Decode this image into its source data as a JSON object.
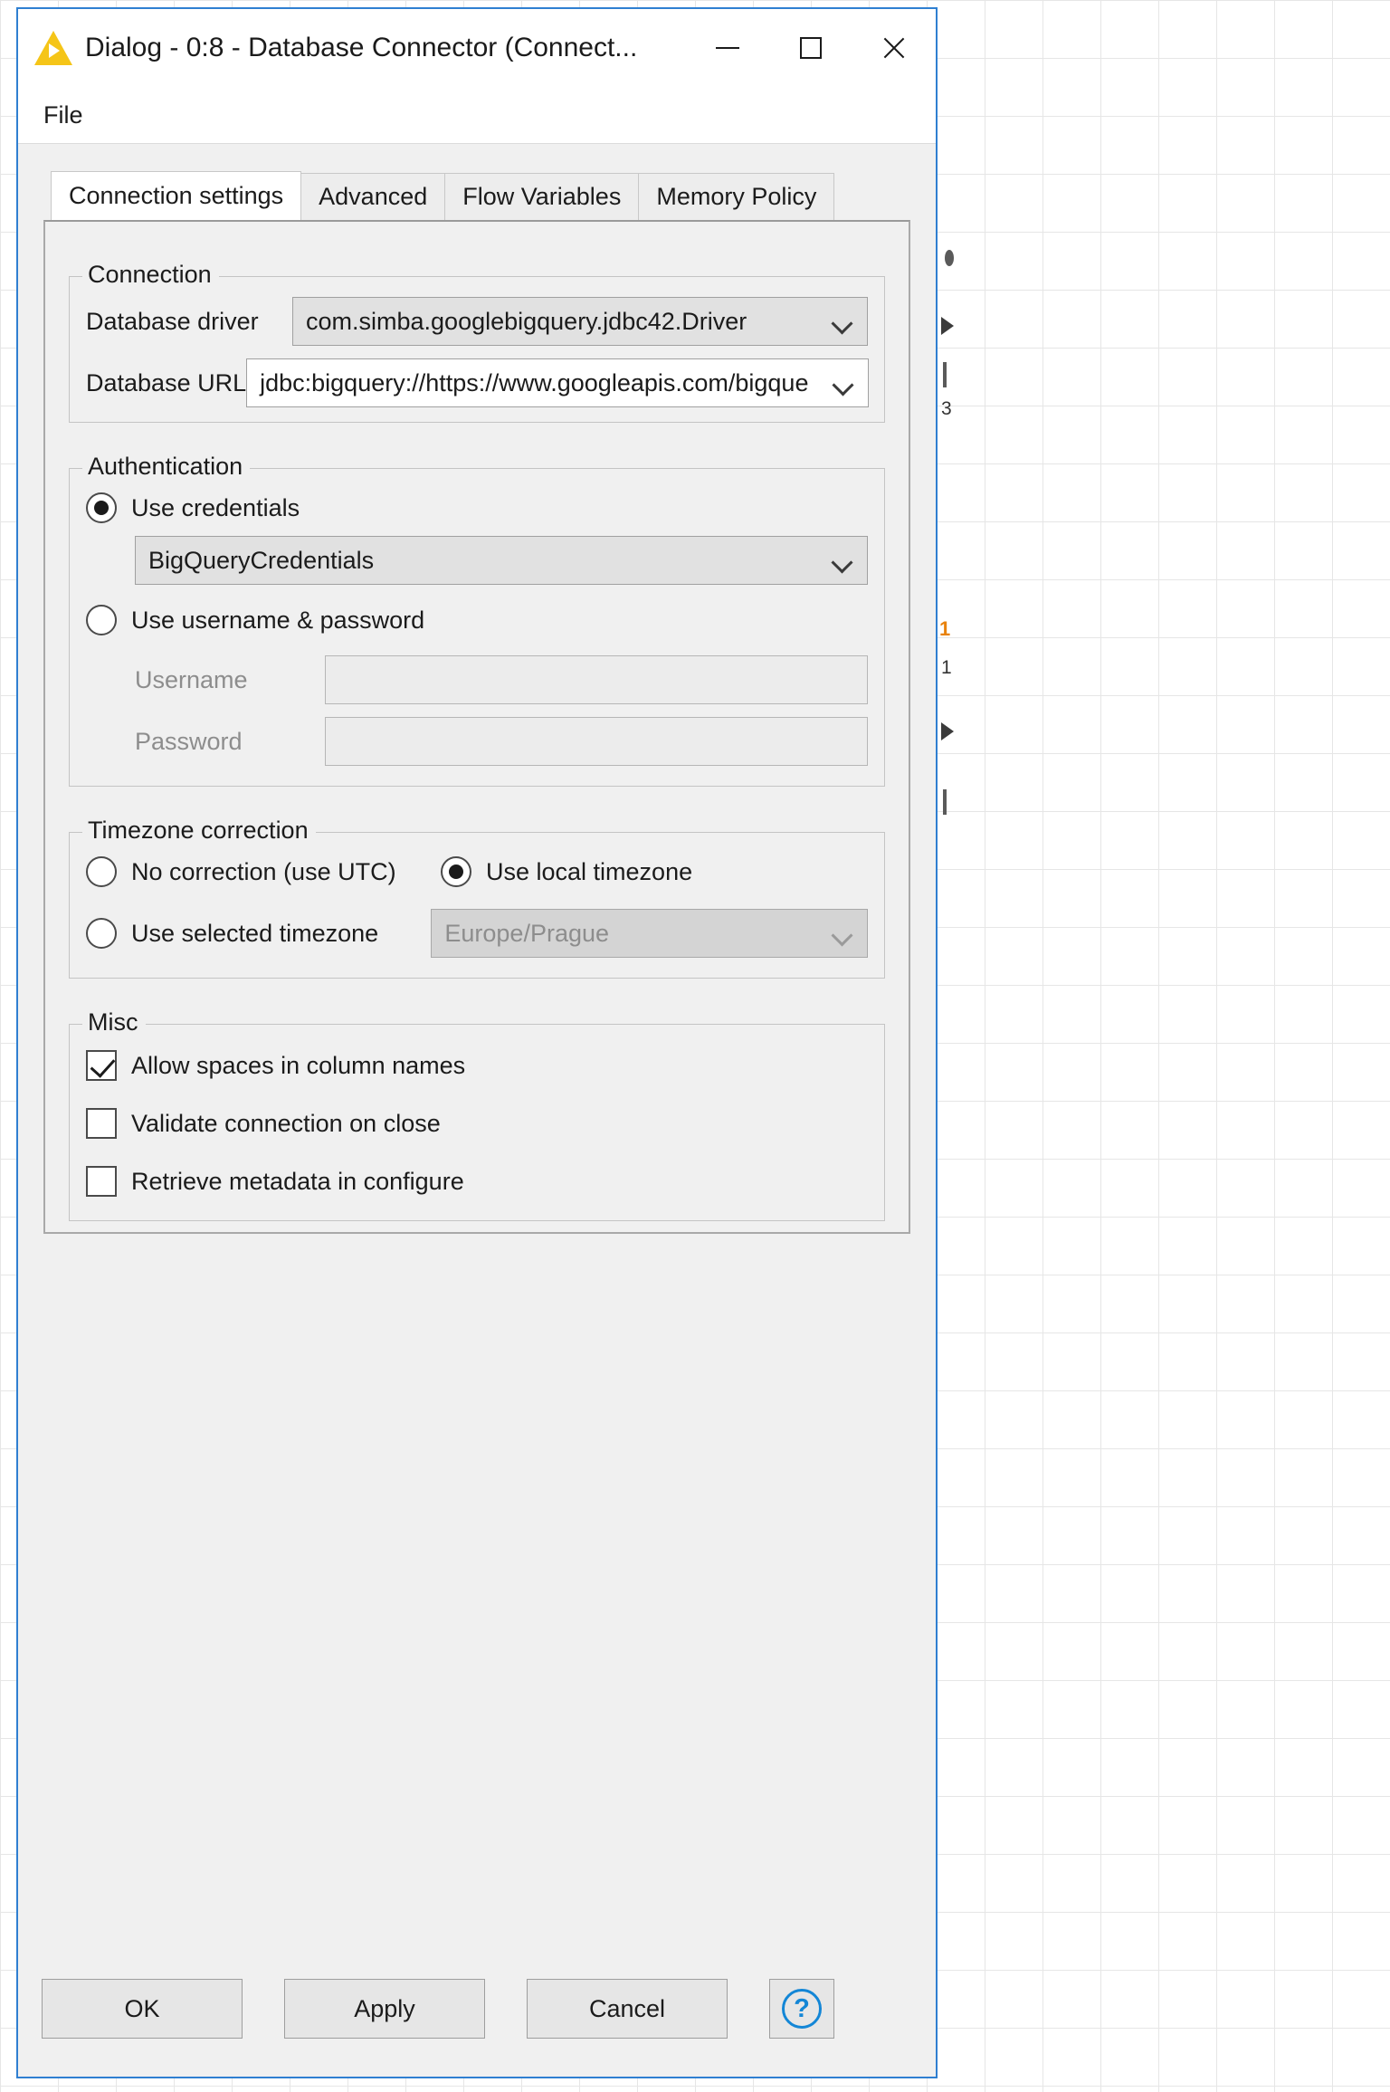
{
  "window": {
    "title": "Dialog - 0:8 - Database Connector (Connect...",
    "icon": "knime-triangle-icon",
    "minimize_label": "─",
    "maximize_label": "□",
    "close_label": "✕"
  },
  "menubar": {
    "items": [
      {
        "label": "File"
      }
    ]
  },
  "tabs": [
    {
      "label": "Connection settings",
      "active": true
    },
    {
      "label": "Advanced",
      "active": false
    },
    {
      "label": "Flow Variables",
      "active": false
    },
    {
      "label": "Memory Policy",
      "active": false
    }
  ],
  "connection": {
    "legend": "Connection",
    "driver_label": "Database driver",
    "driver_value": "com.simba.googlebigquery.jdbc42.Driver",
    "url_label": "Database URL",
    "url_value": "jdbc:bigquery://https://www.googleapis.com/bigque"
  },
  "authentication": {
    "legend": "Authentication",
    "use_credentials_label": "Use credentials",
    "use_credentials_selected": true,
    "credentials_value": "BigQueryCredentials",
    "use_userpass_label": "Use username & password",
    "use_userpass_selected": false,
    "username_label": "Username",
    "username_value": "",
    "password_label": "Password",
    "password_value": ""
  },
  "timezone": {
    "legend": "Timezone correction",
    "no_correction_label": "No correction (use UTC)",
    "no_correction_selected": false,
    "local_label": "Use local timezone",
    "local_selected": true,
    "selected_label": "Use selected timezone",
    "selected_selected": false,
    "selected_value": "Europe/Prague"
  },
  "misc": {
    "legend": "Misc",
    "allow_spaces_label": "Allow spaces in column names",
    "allow_spaces_checked": true,
    "validate_label": "Validate connection on close",
    "validate_checked": false,
    "retrieve_label": "Retrieve metadata in configure",
    "retrieve_checked": false
  },
  "footer": {
    "ok_label": "OK",
    "apply_label": "Apply",
    "cancel_label": "Cancel",
    "help_label": "?"
  },
  "backdrop": {
    "marks": [
      "3",
      "1",
      "1"
    ]
  }
}
